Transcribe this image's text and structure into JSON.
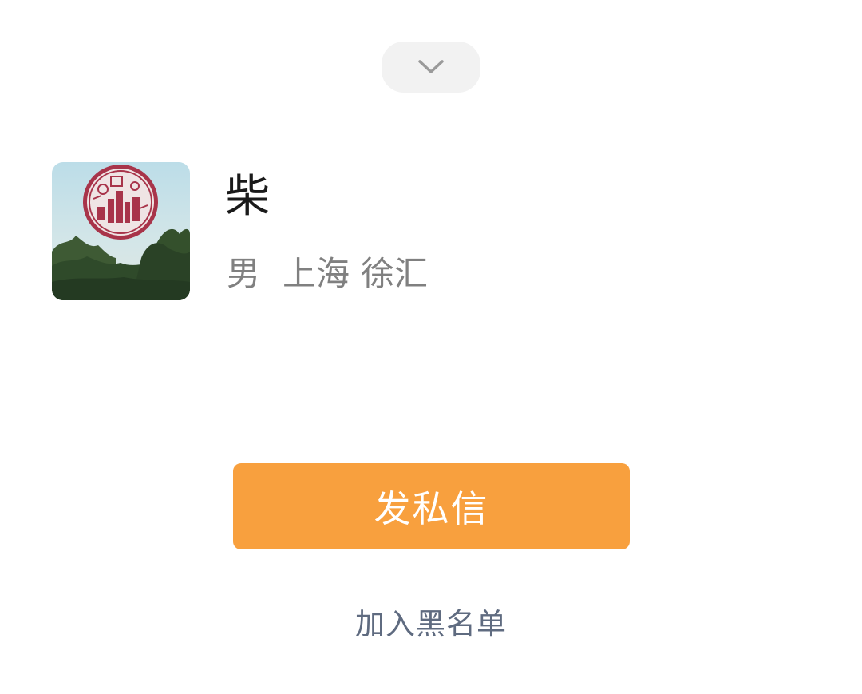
{
  "sheet": {
    "collapse_icon": "chevron-down-icon"
  },
  "profile": {
    "name": "柴",
    "gender": "男",
    "province": "上海",
    "district": "徐汇"
  },
  "actions": {
    "message_label": "发私信",
    "blacklist_label": "加入黑名单"
  },
  "colors": {
    "accent": "#f8a03e",
    "link": "#5f6b80",
    "secondary_text": "#808080"
  }
}
